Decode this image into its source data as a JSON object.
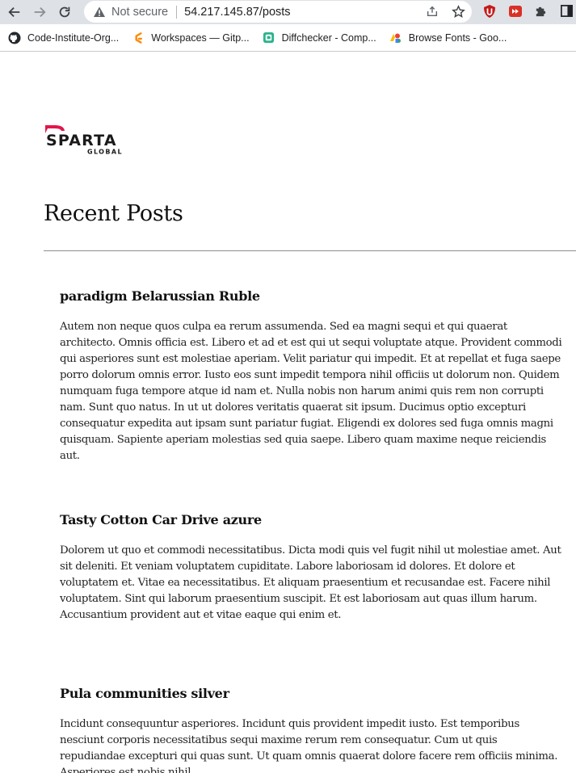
{
  "browser": {
    "not_secure_label": "Not secure",
    "url_host": "54.217.145.87",
    "url_path": "/posts",
    "bookmarks": [
      {
        "label": "Code-Institute-Org...",
        "icon": "github-icon"
      },
      {
        "label": "Workspaces — Gitp...",
        "icon": "gitpod-icon"
      },
      {
        "label": "Diffchecker - Comp...",
        "icon": "diffchecker-icon"
      },
      {
        "label": "Browse Fonts - Goo...",
        "icon": "google-fonts-icon"
      }
    ],
    "colors": {
      "chrome": "#dee1e6",
      "warning": "#5f6368"
    }
  },
  "page": {
    "logo": {
      "word": "SPARTA",
      "sub": "GLOBAL",
      "accent": "#e4154b"
    },
    "title": "Recent Posts",
    "posts": [
      {
        "title": "paradigm Belarussian Ruble",
        "body": "Autem non neque quos culpa ea rerum assumenda. Sed ea magni sequi et qui quaerat architecto. Omnis officia est. Libero et ad et est qui ut sequi voluptate atque. Provident commodi qui asperiores sunt est molestiae aperiam. Velit pariatur qui impedit. Et at repellat et fuga saepe porro dolorum omnis error. Iusto eos sunt impedit tempora nihil officiis ut dolorum non. Quidem numquam fuga tempore atque id nam et. Nulla nobis non harum animi quis rem non corrupti nam. Sunt quo natus. In ut ut dolores veritatis quaerat sit ipsum. Ducimus optio excepturi consequatur expedita aut ipsam sunt pariatur fugiat. Eligendi ex dolores sed fuga omnis magni quisquam. Sapiente aperiam molestias sed quia saepe. Libero quam maxime neque reiciendis aut."
      },
      {
        "title": "Tasty Cotton Car Drive azure",
        "body": "Dolorem ut quo et commodi necessitatibus. Dicta modi quis vel fugit nihil ut molestiae amet. Aut sit deleniti. Et veniam voluptatem cupiditate. Labore laboriosam id dolores. Et dolore et voluptatem et. Vitae ea necessitatibus. Et aliquam praesentium et recusandae est. Facere nihil voluptatem. Sint qui laborum praesentium suscipit. Et est laboriosam aut quas illum harum. Accusantium provident aut et vitae eaque qui enim et."
      },
      {
        "title": "Pula communities silver",
        "body": "Incidunt consequuntur asperiores. Incidunt quis provident impedit iusto. Est temporibus nesciunt corporis necessitatibus sequi maxime rerum rem consequatur. Cum ut quis repudiandae excepturi qui quas sunt. Ut quam omnis quaerat dolore facere rem officiis minima. Asperiores est nobis nihil"
      }
    ]
  }
}
